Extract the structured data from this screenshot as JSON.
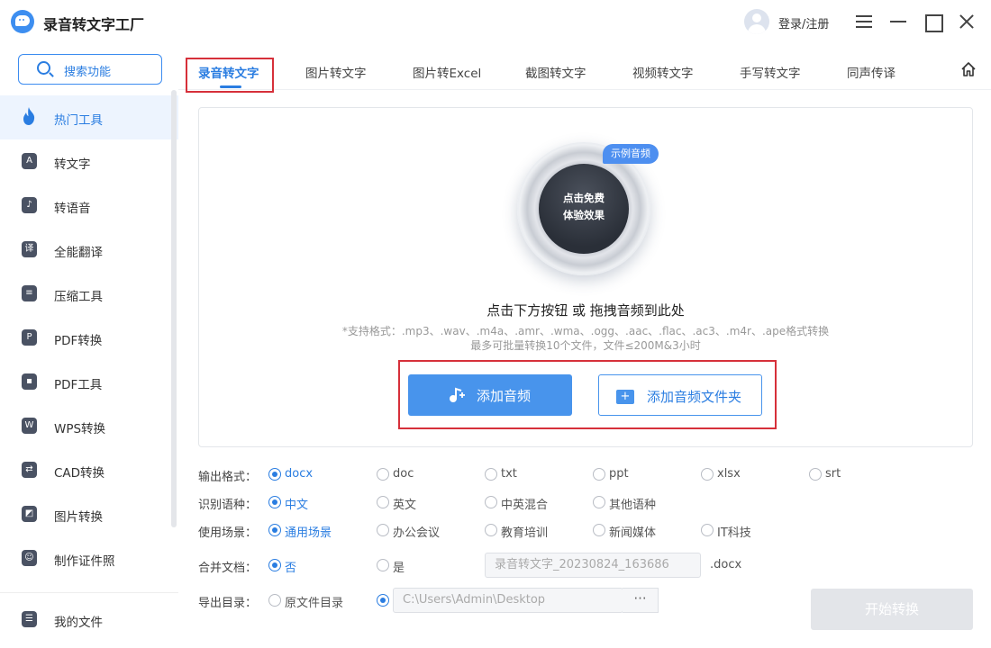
{
  "app": {
    "title": "录音转文字工厂",
    "login": "登录/注册"
  },
  "sidebar": {
    "search_label": "搜索功能",
    "items": [
      {
        "label": "热门工具",
        "icon": "flame-icon",
        "active": true
      },
      {
        "label": "转文字",
        "icon": "text-convert-icon"
      },
      {
        "label": "转语音",
        "icon": "voice-icon"
      },
      {
        "label": "全能翻译",
        "icon": "translate-icon"
      },
      {
        "label": "压缩工具",
        "icon": "compress-icon"
      },
      {
        "label": "PDF转换",
        "icon": "pdf-convert-icon"
      },
      {
        "label": "PDF工具",
        "icon": "pdf-tools-icon"
      },
      {
        "label": "WPS转换",
        "icon": "wps-icon"
      },
      {
        "label": "CAD转换",
        "icon": "cad-icon"
      },
      {
        "label": "图片转换",
        "icon": "image-convert-icon"
      },
      {
        "label": "制作证件照",
        "icon": "id-photo-icon"
      }
    ],
    "my_files": "我的文件"
  },
  "tabs": [
    "录音转文字",
    "图片转文字",
    "图片转Excel",
    "截图转文字",
    "视频转文字",
    "手写转文字",
    "同声传译"
  ],
  "drop": {
    "sample_badge": "示例音频",
    "disc_line1": "点击免费",
    "disc_line2": "体验效果",
    "title": "点击下方按钮 或 拖拽音频到此处",
    "formats": "*支持格式：.mp3、.wav、.m4a、.amr、.wma、.ogg、.aac、.flac、.ac3、.m4r、.ape格式转换",
    "limits": "最多可批量转换10个文件，文件≤200M&3小时",
    "add_audio": "添加音频",
    "add_folder": "添加音频文件夹"
  },
  "options": {
    "output_format": {
      "label": "输出格式：",
      "choices": [
        "docx",
        "doc",
        "txt",
        "ppt",
        "xlsx",
        "srt"
      ],
      "selected": "docx"
    },
    "language": {
      "label": "识别语种：",
      "choices": [
        "中文",
        "英文",
        "中英混合",
        "其他语种"
      ],
      "selected": "中文"
    },
    "scene": {
      "label": "使用场景：",
      "choices": [
        "通用场景",
        "办公会议",
        "教育培训",
        "新闻媒体",
        "IT科技"
      ],
      "selected": "通用场景"
    },
    "merge": {
      "label": "合并文档：",
      "choices": [
        "否",
        "是"
      ],
      "selected": "否",
      "filename": "录音转文字_20230824_163686",
      "suffix": ".docx"
    },
    "export": {
      "label": "导出目录：",
      "original": "原文件目录",
      "path": "C:\\Users\\Admin\\Desktop",
      "browse": "···"
    }
  },
  "start_button": "开始转换",
  "colors": {
    "accent": "#2a7de1",
    "highlight": "#d6303a",
    "sidebar_active": "#edf4fe"
  }
}
